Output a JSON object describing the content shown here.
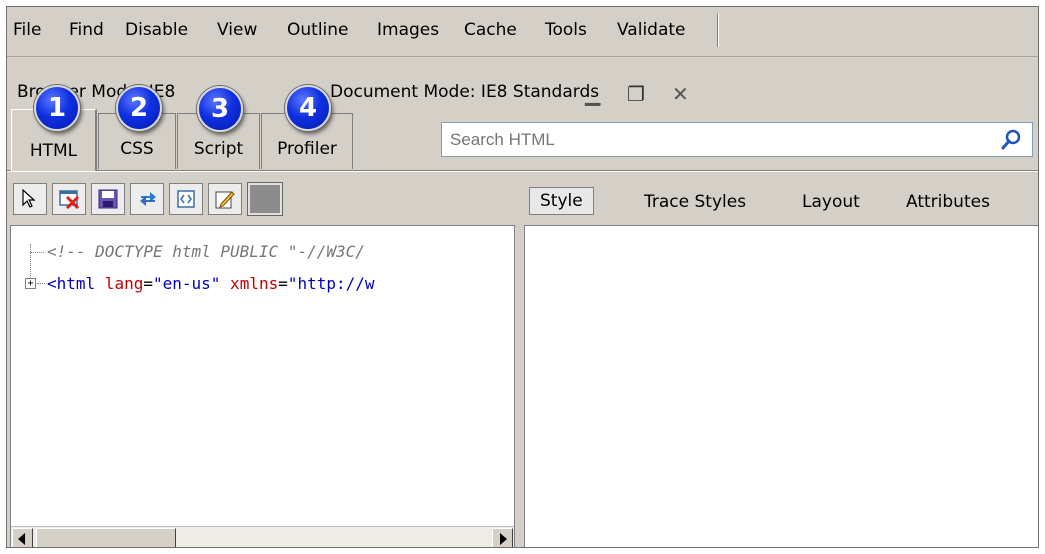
{
  "menu": [
    "File",
    "Find",
    "Disable",
    "View",
    "Outline",
    "Images",
    "Cache",
    "Tools",
    "Validate"
  ],
  "mode_bar": {
    "browser_mode_text": "Browser Mode: IE8",
    "document_mode_text": "Document Mode: IE8 Standards"
  },
  "window_controls": {
    "minimize": "▁",
    "restore": "❐",
    "close": "✕"
  },
  "tabs": [
    {
      "label": "HTML",
      "badge": "1"
    },
    {
      "label": "CSS",
      "badge": "2"
    },
    {
      "label": "Script",
      "badge": "3"
    },
    {
      "label": "Profiler",
      "badge": "4"
    }
  ],
  "search": {
    "placeholder": "Search HTML"
  },
  "toolbar_icons": [
    "select-element-icon",
    "clear-browser-cache-icon",
    "save-icon",
    "refresh-icon",
    "element-source-icon",
    "edit-icon",
    "color-icon"
  ],
  "right_tabs": [
    "Style",
    "Trace Styles",
    "Layout",
    "Attributes"
  ],
  "tree": {
    "comment_line": "<!-- DOCTYPE html PUBLIC \"-//W3C/",
    "html_open": "<html",
    "attr1_name": " lang",
    "attr1_eq": "=",
    "attr1_val": "\"en-us\"",
    "attr2_name": " xmlns",
    "attr2_eq": "=",
    "attr2_val": "\"http://w",
    "expander": "+"
  },
  "colors": {
    "chrome": "#d4d0c8",
    "badge": "#1030e0",
    "tag": "#0000c0",
    "attr": "#c00000",
    "comment": "#777777"
  }
}
